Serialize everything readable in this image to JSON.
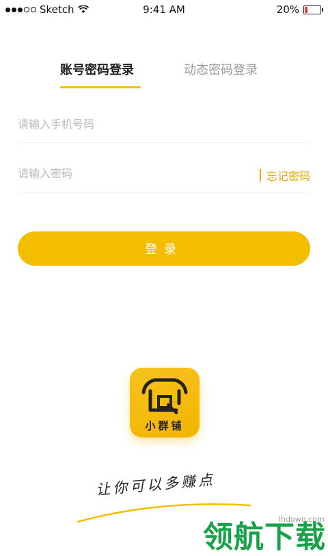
{
  "status_bar": {
    "carrier": "Sketch",
    "time": "9:41 AM",
    "battery_percent": "20%",
    "battery_level": 0.2,
    "battery_color": "#e53935"
  },
  "tabs": {
    "active": "账号密码登录",
    "inactive": "动态密码登录"
  },
  "phone_field": {
    "placeholder": "请输入手机号码",
    "value": ""
  },
  "password_field": {
    "placeholder": "请输入密码",
    "value": "",
    "forgot_label": "忘记密码"
  },
  "login_button": {
    "label": "登录"
  },
  "app_logo": {
    "name": "小群铺",
    "icon": "house-icon"
  },
  "slogan": "让你可以多赚点",
  "watermark": {
    "url": "lhdown.com",
    "text": "领航下载"
  },
  "colors": {
    "accent": "#f3be00",
    "link": "#e9a800",
    "placeholder": "#b9b9b9"
  }
}
